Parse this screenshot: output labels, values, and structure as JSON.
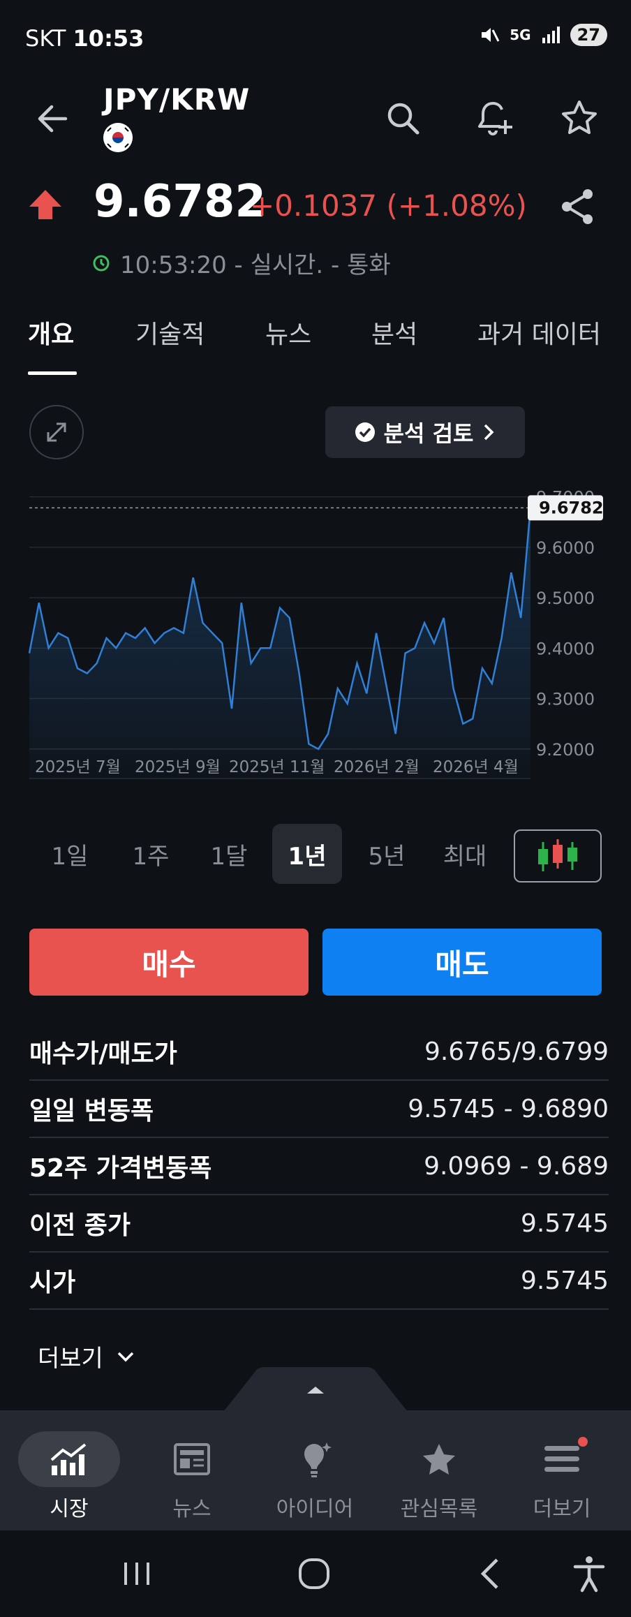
{
  "status_bar": {
    "carrier": "SKT",
    "time": "10:53",
    "network": "5G",
    "battery": "27"
  },
  "header": {
    "symbol": "JPY/KRW"
  },
  "quote": {
    "price": "9.6782",
    "change": "+0.1037 (+1.08%)",
    "timestamp": "10:53:20 - 실시간. - 통화",
    "up_color": "#e8534f"
  },
  "tabs": [
    "개요",
    "기술적",
    "뉴스",
    "분석",
    "과거 데이터"
  ],
  "chart_toolbar": {
    "review_label": "분석 검토"
  },
  "chart_data": {
    "type": "area",
    "x_tick_labels": [
      "2025년 7월",
      "2025년 9월",
      "2025년 11월",
      "2026년 2월",
      "2026년 4월"
    ],
    "y_ticks": [
      "9.2000",
      "9.3000",
      "9.4000",
      "9.5000",
      "9.6000",
      "9.7000"
    ],
    "ylim": [
      9.19,
      9.73
    ],
    "current_label": "9.6782",
    "current_value": 9.6782,
    "line_color": "#2f80d6",
    "values": [
      9.39,
      9.49,
      9.4,
      9.43,
      9.42,
      9.36,
      9.35,
      9.37,
      9.42,
      9.4,
      9.43,
      9.42,
      9.44,
      9.41,
      9.43,
      9.44,
      9.43,
      9.54,
      9.45,
      9.43,
      9.41,
      9.28,
      9.49,
      9.37,
      9.4,
      9.4,
      9.48,
      9.46,
      9.35,
      9.21,
      9.2,
      9.23,
      9.32,
      9.29,
      9.37,
      9.31,
      9.43,
      9.33,
      9.23,
      9.39,
      9.4,
      9.45,
      9.41,
      9.46,
      9.32,
      9.25,
      9.26,
      9.36,
      9.33,
      9.42,
      9.55,
      9.46,
      9.6782
    ]
  },
  "periods": [
    "1일",
    "1주",
    "1달",
    "1년",
    "5년",
    "최대"
  ],
  "active_period": "1년",
  "trade": {
    "buy": "매수",
    "sell": "매도"
  },
  "stats": [
    {
      "label": "매수가/매도가",
      "value": "9.6765/9.6799"
    },
    {
      "label": "일일 변동폭",
      "value": "9.5745 - 9.6890"
    },
    {
      "label": "52주 가격변동폭",
      "value": "9.0969 - 9.689"
    },
    {
      "label": "이전 종가",
      "value": "9.5745"
    },
    {
      "label": "시가",
      "value": "9.5745"
    }
  ],
  "more_label": "더보기",
  "bottom_nav": [
    "시장",
    "뉴스",
    "아이디어",
    "관심목록",
    "더보기"
  ]
}
